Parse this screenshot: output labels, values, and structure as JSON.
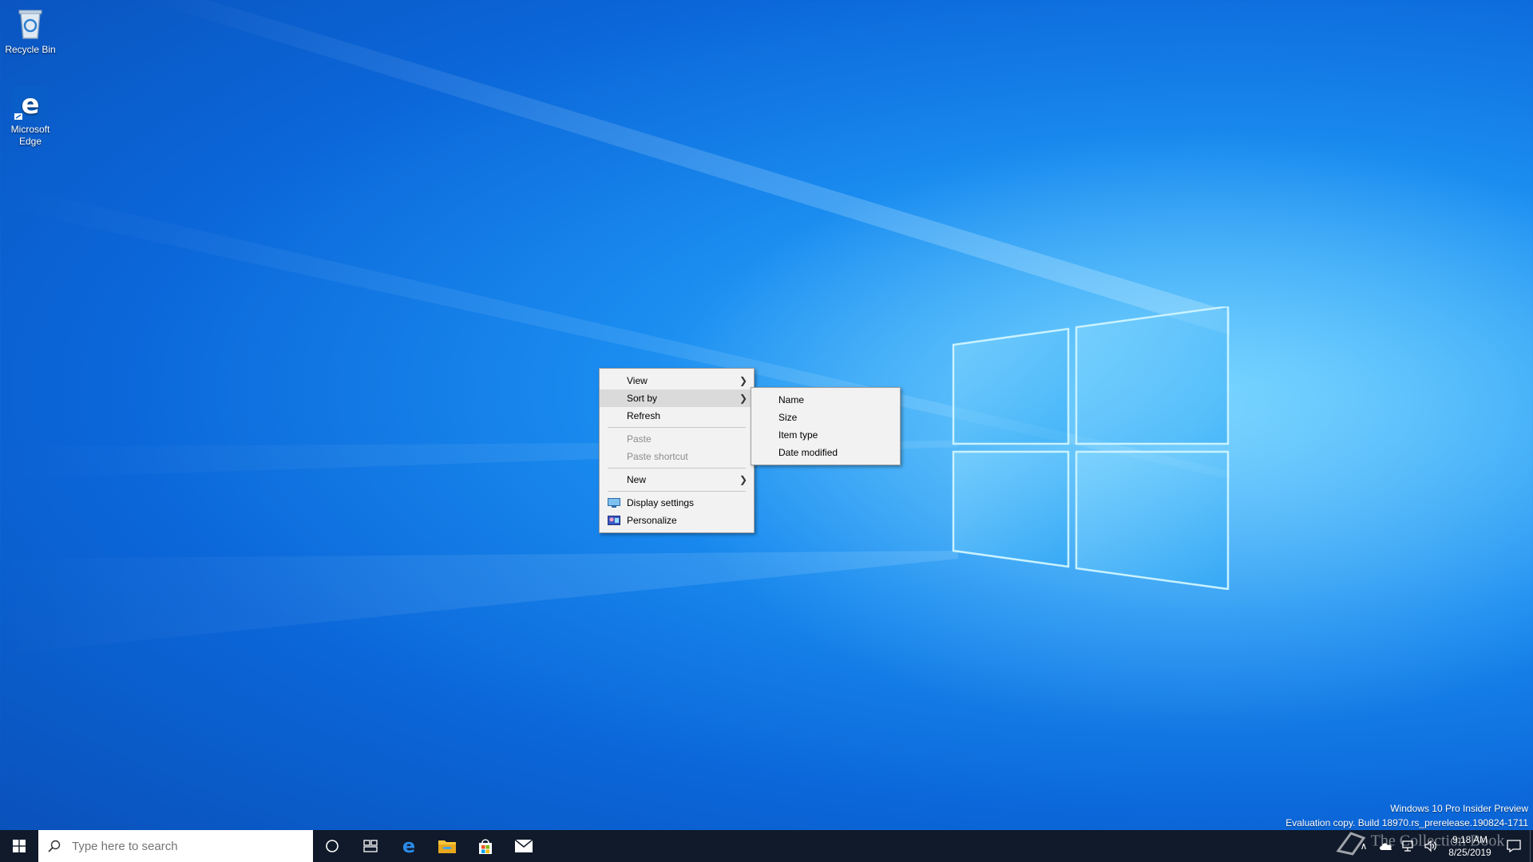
{
  "desktop": {
    "icons": [
      {
        "label": "Recycle Bin",
        "icon": "recycle-bin-icon"
      },
      {
        "label": "Microsoft Edge",
        "icon": "edge-icon"
      }
    ]
  },
  "context_menu": {
    "items": [
      {
        "label": "View",
        "has_submenu": true
      },
      {
        "label": "Sort by",
        "has_submenu": true,
        "highlighted": true
      },
      {
        "label": "Refresh"
      },
      {
        "label": "Paste",
        "disabled": true
      },
      {
        "label": "Paste shortcut",
        "disabled": true
      },
      {
        "label": "New",
        "has_submenu": true
      },
      {
        "label": "Display settings",
        "icon": "display-settings-icon"
      },
      {
        "label": "Personalize",
        "icon": "personalize-icon"
      }
    ]
  },
  "sort_submenu": {
    "items": [
      {
        "label": "Name"
      },
      {
        "label": "Size"
      },
      {
        "label": "Item type"
      },
      {
        "label": "Date modified"
      }
    ]
  },
  "taskbar": {
    "search_placeholder": "Type here to search",
    "pinned": [
      "cortana-icon",
      "task-view-icon",
      "edge-icon",
      "file-explorer-icon",
      "store-icon",
      "mail-icon"
    ],
    "clock_time": "9:18 AM",
    "clock_date": "8/25/2019"
  },
  "watermark": {
    "line1": "Windows 10 Pro Insider Preview",
    "line2": "Evaluation copy. Build 18970.rs_prerelease.190824-1711",
    "overlay": "The Collection Book"
  },
  "colors": {
    "taskbar": "#101a2a",
    "menu_bg": "#f2f2f2",
    "menu_highlight": "#dadada",
    "accent": "#0078d7"
  }
}
